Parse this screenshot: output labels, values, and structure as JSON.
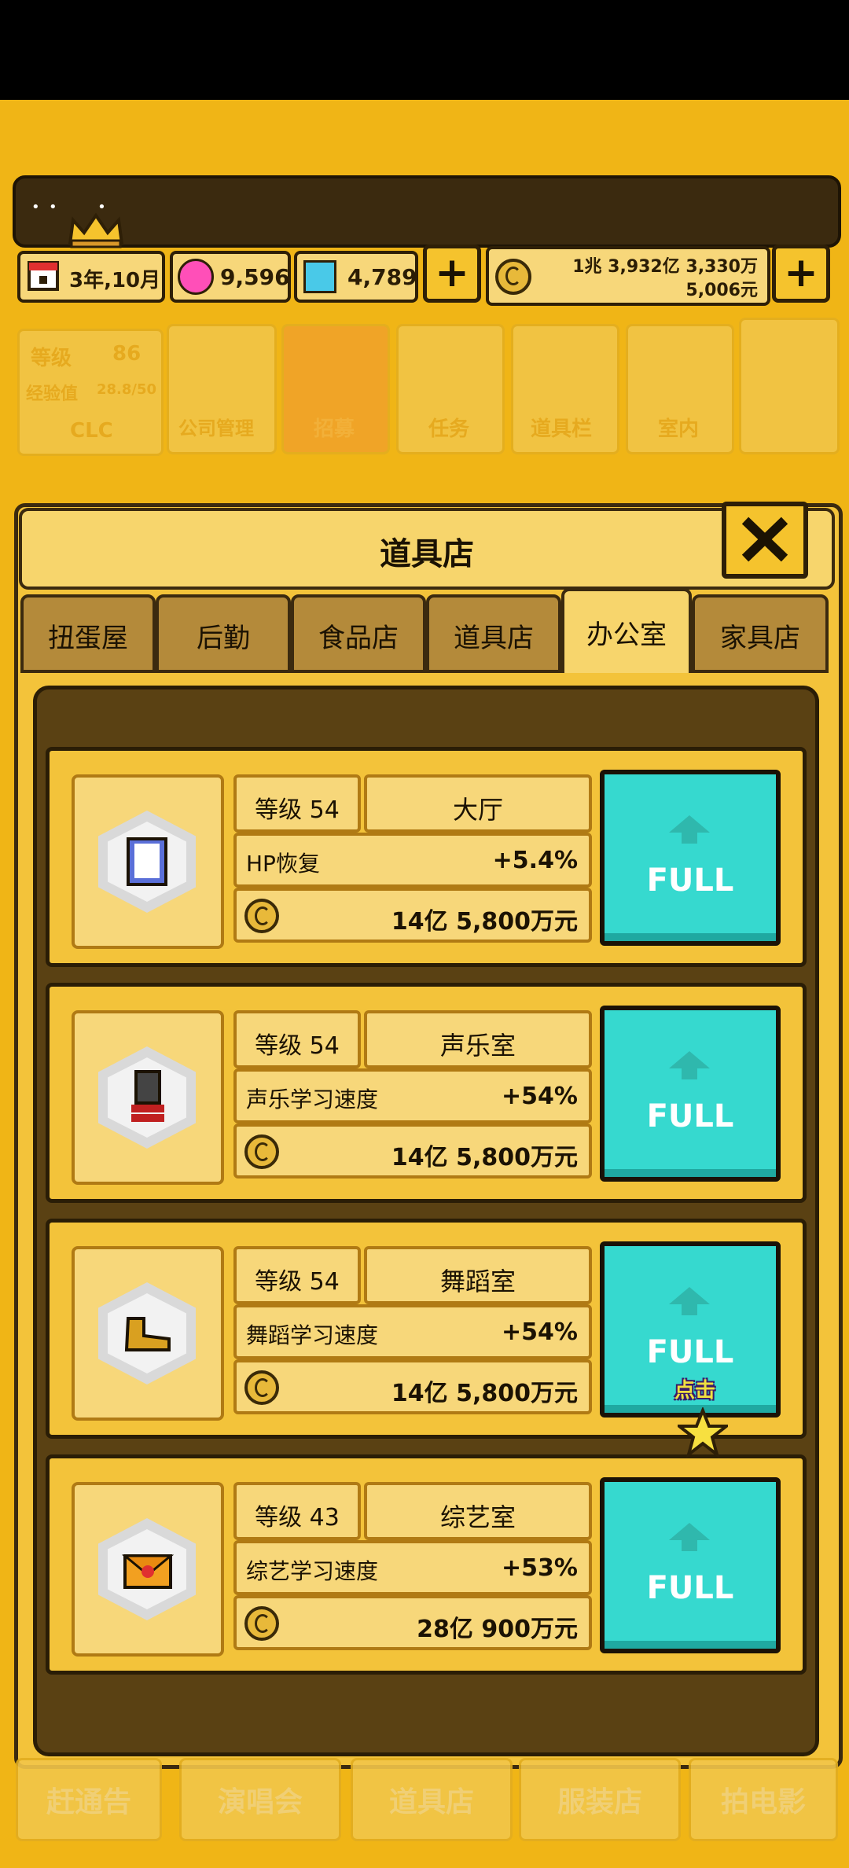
{
  "topbar": {
    "date": "3年,10月",
    "hearts": "9,596",
    "diamonds": "4,789",
    "money_line1": "1兆 3,932亿 3,330万",
    "money_line2": "5,006元",
    "plus": "+"
  },
  "bg_menu": {
    "level_label": "等级",
    "level_value": "86",
    "exp_label": "经验值",
    "exp_value": "28.8/50",
    "company_name": "CLC",
    "items": [
      "公司管理",
      "招募",
      "任务",
      "道具栏",
      "室内"
    ]
  },
  "panel": {
    "title": "道具店",
    "close": "✕",
    "tabs": [
      "扭蛋屋",
      "后勤",
      "食品店",
      "道具店",
      "办公室",
      "家具店"
    ],
    "active_tab": 4
  },
  "items": [
    {
      "level": "等级 54",
      "name": "大厅",
      "stat_label": "HP恢复",
      "stat_value": "+5.4%",
      "cost": "14亿 5,800万元",
      "button": "FULL",
      "icon": "clipboard-icon"
    },
    {
      "level": "等级 54",
      "name": "声乐室",
      "stat_label": "声乐学习速度",
      "stat_value": "+54%",
      "cost": "14亿 5,800万元",
      "button": "FULL",
      "icon": "microphone-icon"
    },
    {
      "level": "等级 54",
      "name": "舞蹈室",
      "stat_label": "舞蹈学习速度",
      "stat_value": "+54%",
      "cost": "14亿 5,800万元",
      "button": "FULL",
      "icon": "dance-shoe-icon"
    },
    {
      "level": "等级 43",
      "name": "综艺室",
      "stat_label": "综艺学习速度",
      "stat_value": "+53%",
      "cost": "28亿 900万元",
      "button": "FULL",
      "icon": "heart-envelope-icon"
    }
  ],
  "hint": "点击",
  "bottom_nav": [
    "赶通告",
    "演唱会",
    "道具店",
    "服装店",
    "拍电影"
  ],
  "colors": {
    "accent_teal": "#36d9cf",
    "panel_yellow": "#f3c33a",
    "dark_brown": "#3b2a0f"
  }
}
